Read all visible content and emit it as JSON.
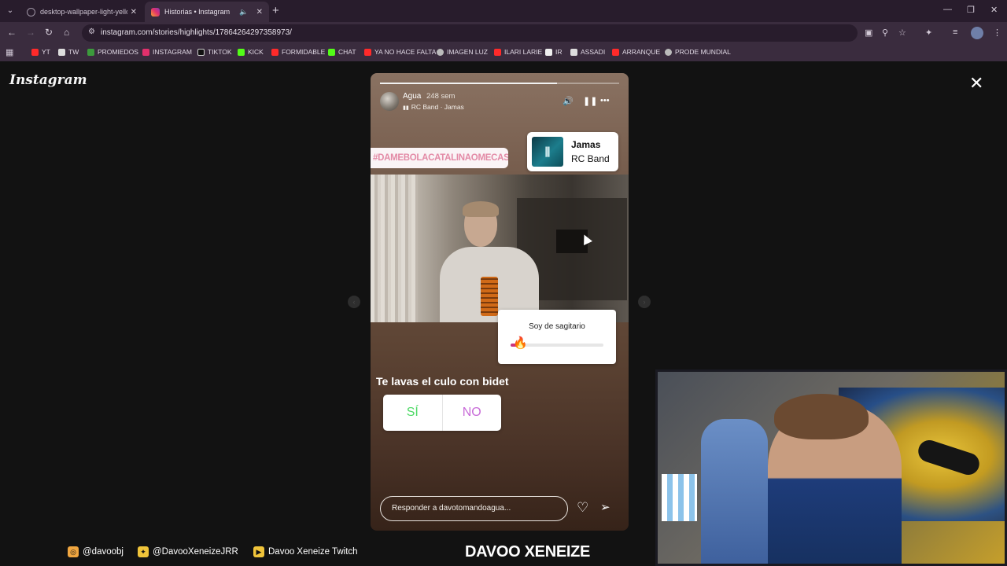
{
  "browser": {
    "tabs": [
      {
        "title": "desktop-wallpaper-light-yellow...",
        "active": false
      },
      {
        "title": "Historias • Instagram",
        "active": true
      }
    ],
    "url": "instagram.com/stories/highlights/17864264297358973/",
    "bookmarks": [
      "YT",
      "TW",
      "PROMIEDOS",
      "INSTAGRAM",
      "TIKTOK",
      "KICK",
      "FORMIDABLE",
      "CHAT",
      "YA NO HACE FALTA",
      "IMAGEN LUZ",
      "ILARI LARIE",
      "IR",
      "ASSADI",
      "ARRANQUE",
      "PRODE MUNDIAL"
    ]
  },
  "instagram": {
    "logo": "Instagram",
    "story": {
      "progress": 0.74,
      "username": "Agua",
      "time": "248 sem",
      "music": "RC Band · Jamas",
      "hashtag": "#DAMEBOLACATALINAOMECASTRO",
      "music_sticker": {
        "song": "Jamas",
        "artist": "RC Band"
      },
      "slider_question": "Soy de sagitario",
      "slider_value": 0.08,
      "slider_emoji": "🔥",
      "poll_question": "Te lavas el culo con bidet",
      "poll_yes": "SÍ",
      "poll_no": "NO",
      "reply_placeholder": "Responder a davotomandoagua..."
    }
  },
  "stream": {
    "instagram": "@davoobj",
    "twitter": "@DavooXeneizeJRR",
    "youtube": "Davoo Xeneize Twitch",
    "brand": "DAVOO XENEIZE"
  },
  "colors": {
    "accent": "#e1306c",
    "poll_yes": "#4cd964",
    "poll_no": "#c86cd8",
    "chrome": "#3a2c3e"
  }
}
